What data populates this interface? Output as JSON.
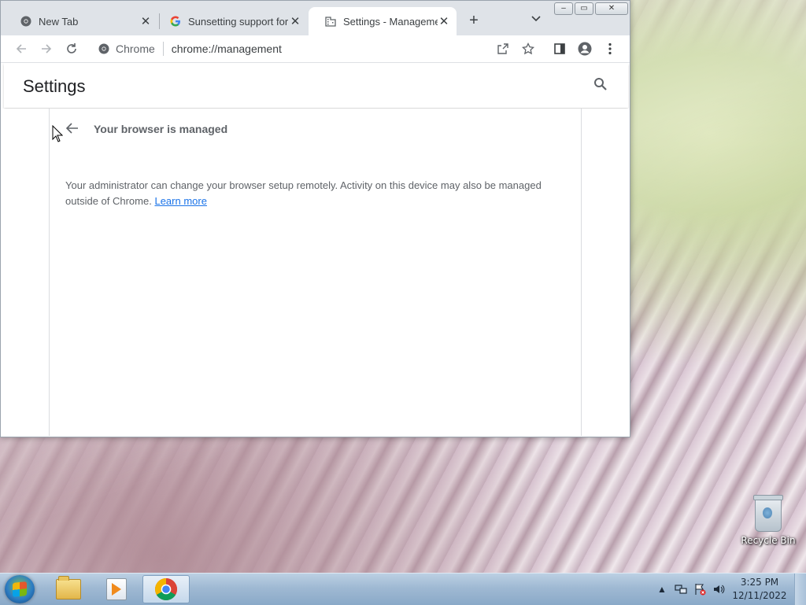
{
  "desktop": {
    "recycle_bin_label": "Recycle Bin"
  },
  "browser": {
    "tabs": [
      {
        "title": "New Tab",
        "icon": "chrome-icon",
        "active": false
      },
      {
        "title": "Sunsetting support for",
        "icon": "google-icon",
        "active": false
      },
      {
        "title": "Settings - Management",
        "icon": "building-icon",
        "active": true
      }
    ],
    "new_tab_label": "+",
    "omnibox": {
      "chip_label": "Chrome",
      "url": "chrome://management"
    }
  },
  "settings": {
    "title": "Settings",
    "page_heading": "Your browser is managed",
    "description": "Your administrator can change your browser setup remotely. Activity on this device may also be managed outside of Chrome.",
    "learn_more": "Learn more"
  },
  "taskbar": {
    "time": "3:25 PM",
    "date": "12/11/2022"
  },
  "colors": {
    "link": "#1a73e8",
    "tabstrip": "#dfe3e8",
    "text_secondary": "#5f6368"
  }
}
